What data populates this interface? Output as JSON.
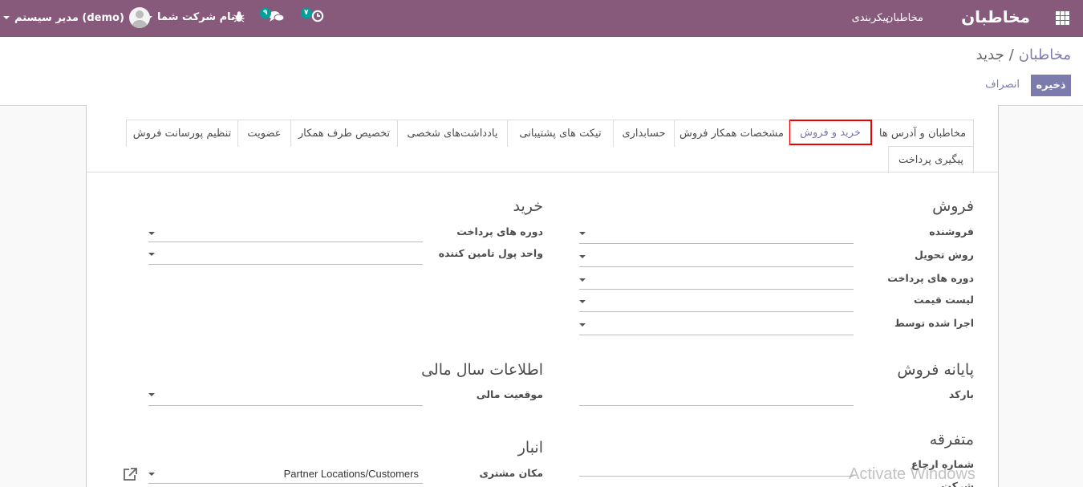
{
  "navbar": {
    "app_title": "مخاطبان",
    "menu": [
      "مخاطبان",
      "پیکربندی"
    ],
    "activity_badge": "۷",
    "messages_badge": "۹",
    "company": "نام شرکت شما",
    "user": "مدیر سیستم (demo)",
    "bg_color": "#875a7b"
  },
  "breadcrumb": {
    "parent": "مخاطبان",
    "separator": "/",
    "current": "جدید"
  },
  "buttons": {
    "save": "ذخیره",
    "discard": "انصراف"
  },
  "tabs": [
    "مخاطبان و آدرس ها",
    "خرید و فروش",
    "مشخصات همکار فروش",
    "حسابداری",
    "تیکت های پشتیبانی",
    "یادداشت‌های شخصی",
    "تخصیص طرف همکار",
    "عضویت",
    "تنظیم پورسانت فروش",
    "پیگیری پرداخت"
  ],
  "active_tab": "خرید و فروش",
  "sections": {
    "sales": {
      "title": "فروش",
      "fields": [
        "فروشنده",
        "روش تحویل",
        "دوره های پرداخت",
        "لیست قیمت",
        "اجرا شده توسط"
      ]
    },
    "purchase": {
      "title": "خرید",
      "fields": [
        "دوره های پرداخت",
        "واحد پول تامین کننده"
      ]
    },
    "pos": {
      "title": "پایانه فروش",
      "fields": [
        "بارکد"
      ]
    },
    "fiscal": {
      "title": "اطلاعات سال مالی",
      "fields": [
        "موقعیت مالی"
      ]
    },
    "misc": {
      "title": "متفرقه",
      "fields": [
        "شماره ارجاع",
        "شرکت"
      ]
    },
    "inventory": {
      "title": "انبار",
      "fields": [
        "مکان مشتری"
      ],
      "customer_location_value": "Partner Locations/Customers"
    }
  },
  "watermark": "Activate Windows"
}
